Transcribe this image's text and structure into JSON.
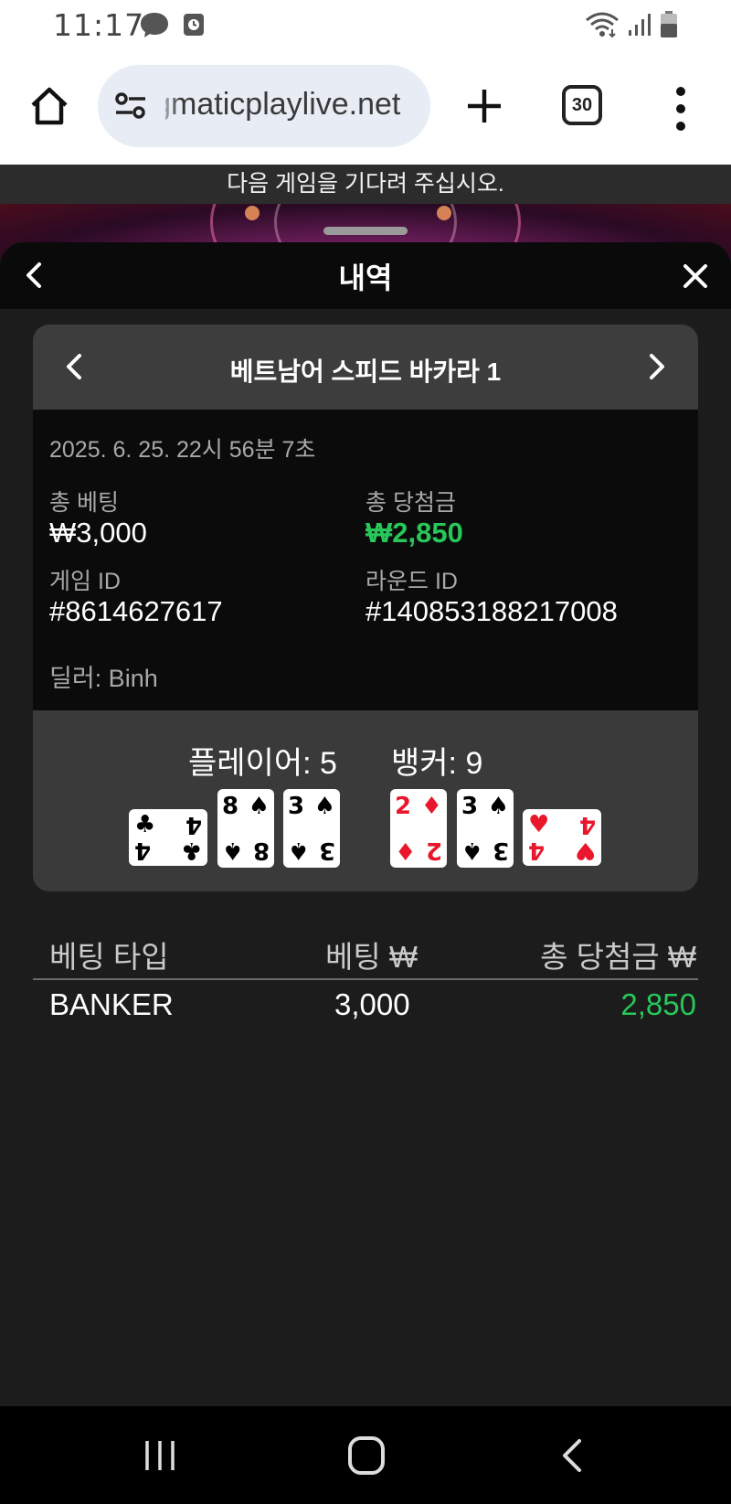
{
  "status_bar": {
    "time": "11:17",
    "left_icons": [
      "messenger-icon",
      "clock-app-icon"
    ],
    "right_icons": [
      "wifi-icon",
      "signal-icon",
      "battery-icon"
    ]
  },
  "browser": {
    "url": "pragmaticplaylive.net",
    "tab_count": "30"
  },
  "notice": "다음 게임을 기다려 주십시오.",
  "panel": {
    "title": "내역"
  },
  "game": {
    "name": "베트남어 스피드 바카라 1",
    "datetime": "2025. 6. 25. 22시 56분 7초",
    "total_bet_label": "총 베팅",
    "total_bet_value": "₩3,000",
    "total_win_label": "총 당첨금",
    "total_win_value": "₩2,850",
    "game_id_label": "게임 ID",
    "game_id_value": "#8614627617",
    "round_id_label": "라운드 ID",
    "round_id_value": "#140853188217008",
    "dealer": "딜러: Binh",
    "player_score": "플레이어: 5",
    "banker_score": "뱅커: 9",
    "player_cards": [
      {
        "rank": "4",
        "suit": "♣",
        "color": "black",
        "orientation": "sideways"
      },
      {
        "rank": "8",
        "suit": "♠",
        "color": "black",
        "orientation": "upright"
      },
      {
        "rank": "3",
        "suit": "♠",
        "color": "black",
        "orientation": "upright"
      }
    ],
    "banker_cards": [
      {
        "rank": "2",
        "suit": "♦",
        "color": "red",
        "orientation": "upright"
      },
      {
        "rank": "3",
        "suit": "♠",
        "color": "black",
        "orientation": "upright"
      },
      {
        "rank": "4",
        "suit": "♥",
        "color": "red",
        "orientation": "sideways"
      }
    ]
  },
  "bets_table": {
    "headers": [
      "베팅 타입",
      "베팅 ₩",
      "총 당첨금 ₩"
    ],
    "rows": [
      {
        "type": "BANKER",
        "bet": "3,000",
        "win": "2,850"
      }
    ]
  },
  "colors": {
    "win_green": "#27c75a",
    "panel_bg": "#1c1c1c",
    "card_header_bg": "#3d3d3d",
    "info_bg": "#0b0b0b"
  },
  "nav_bar": {
    "icons": [
      "recent-apps-icon",
      "home-icon",
      "back-icon"
    ]
  }
}
